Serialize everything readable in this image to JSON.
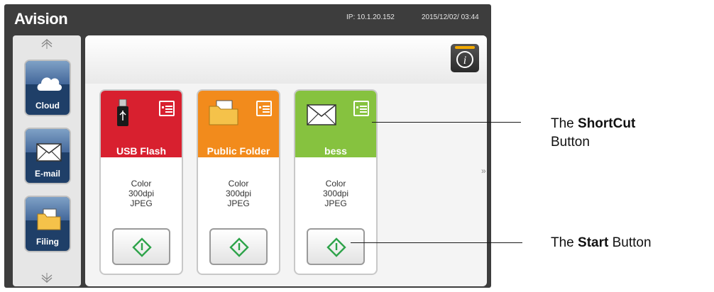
{
  "header": {
    "brand": "Avision",
    "ip": "IP: 10.1.20.152",
    "datetime": "2015/12/02/ 03:44"
  },
  "sidebar": {
    "items": [
      {
        "label": "Cloud",
        "icon": "cloud-icon"
      },
      {
        "label": "E-mail",
        "icon": "envelope-icon"
      },
      {
        "label": "Filing",
        "icon": "folder-icon"
      }
    ]
  },
  "cards": [
    {
      "title": "USB Flash",
      "color": "#d8202f",
      "icon": "usb-drive-icon",
      "lines": [
        "Color",
        "300dpi",
        "JPEG"
      ]
    },
    {
      "title": "Public Folder",
      "color": "#f28b1c",
      "icon": "folder-icon",
      "lines": [
        "Color",
        "300dpi",
        "JPEG"
      ]
    },
    {
      "title": "bess",
      "color": "#86c23f",
      "icon": "envelope-icon",
      "lines": [
        "Color",
        "300dpi",
        "JPEG"
      ]
    }
  ],
  "navigation": {
    "next_label": "»"
  },
  "callouts": {
    "shortcut": {
      "prefix": "The ",
      "bold": "ShortCut",
      "suffix": "Button"
    },
    "start": {
      "prefix": "The ",
      "bold": "Start",
      "suffix": " Button"
    }
  }
}
